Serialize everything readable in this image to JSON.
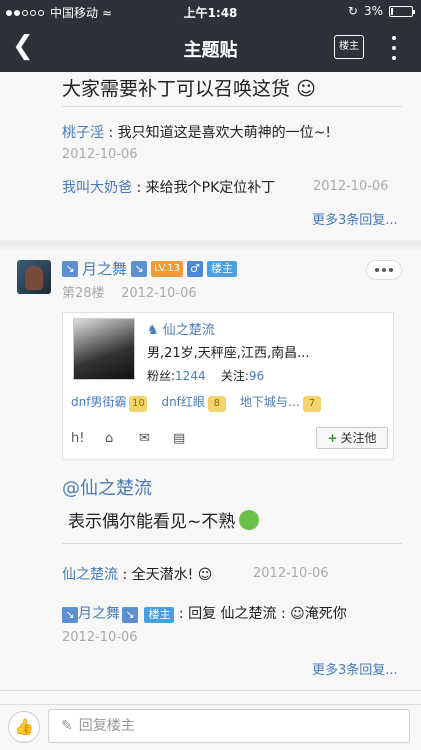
{
  "status_bar": {
    "carrier": "中国移动",
    "time": "上午1:48",
    "battery": "3%"
  },
  "nav": {
    "title": "主题贴",
    "louzhu_label": "楼主"
  },
  "prev_post": {
    "text_tail": "大家需要补丁可以召唤这货",
    "replies": [
      {
        "user": "桃子淫",
        "sep": " : ",
        "text": "我只知道这是喜欢大萌神的一位~!",
        "date": "2012-10-06"
      },
      {
        "user": "我叫大奶爸",
        "sep": " : ",
        "text": "来给我个PK定位补丁",
        "date": "2012-10-06"
      }
    ],
    "more_replies": "更多3条回复..."
  },
  "post": {
    "username": "月之舞",
    "level": "LV.13",
    "louzhu_badge": "楼主",
    "floor": "第28楼",
    "date": "2012-10-06",
    "card": {
      "name": "仙之楚流",
      "info": "男,21岁,天秤座,江西,南昌...",
      "fans_label": "粉丝:",
      "fans": "1244",
      "follow_label": "关注:",
      "follow": "96",
      "tags": [
        {
          "name": "dnf男街霸",
          "level": "10"
        },
        {
          "name": "dnf红眼",
          "level": "8"
        },
        {
          "name": "地下城与…",
          "level": "7"
        }
      ],
      "follow_button": "关注他"
    },
    "at_text": "@仙之楚流",
    "body": "表示偶尔能看见~不熟",
    "replies": [
      {
        "user": "仙之楚流",
        "sep": " : ",
        "text": "全天潜水!",
        "date": "2012-10-06"
      },
      {
        "user": "月之舞",
        "louzhu": "楼主",
        "sep": " : ",
        "prefix": "回复 ",
        "target": "仙之楚流",
        "text": "淹死你",
        "date": "2012-10-06"
      }
    ],
    "more_replies": "更多3条回复..."
  },
  "bottom": {
    "reply_placeholder": "回复楼主"
  }
}
